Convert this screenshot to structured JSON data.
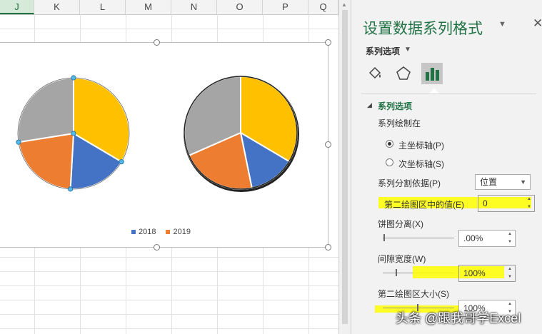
{
  "spreadsheet": {
    "columns": [
      "J",
      "K",
      "L",
      "M",
      "N",
      "O",
      "P",
      "Q"
    ],
    "active_column": "J"
  },
  "chart_data": {
    "type": "pie",
    "subtype": "pie-of-pie",
    "legend": [
      "2018",
      "2019"
    ],
    "legend_position": "bottom",
    "colors": {
      "2018": "#4472c4",
      "2019": "#ed7d31",
      "gray": "#a5a5a5",
      "yellow": "#ffc000"
    },
    "pies": [
      {
        "slices": [
          {
            "color": "#ffc000",
            "share": 0.335
          },
          {
            "color": "#4472c4",
            "share": 0.174
          },
          {
            "color": "#ed7d31",
            "share": 0.216
          },
          {
            "color": "#a5a5a5",
            "share": 0.275
          }
        ]
      },
      {
        "slices": [
          {
            "color": "#ffc000",
            "share": 0.335
          },
          {
            "color": "#4472c4",
            "share": 0.133
          },
          {
            "color": "#ed7d31",
            "share": 0.216
          },
          {
            "color": "#a5a5a5",
            "share": 0.316
          }
        ]
      }
    ]
  },
  "pane": {
    "title": "设置数据系列格式",
    "subtitle": "系列选项",
    "section": "系列选项",
    "plot_on_label": "系列绘制在",
    "primary_axis": "主坐标轴(P)",
    "secondary_axis": "次坐标轴(S)",
    "split_by_label": "系列分割依据(P)",
    "split_by_value": "位置",
    "values_in_second_label": "第二绘图区中的值(E)",
    "values_in_second_value": "0",
    "explosion_label": "饼图分离(X)",
    "explosion_value": ".00%",
    "gap_width_label": "间隙宽度(W)",
    "gap_width_value": "100%",
    "second_size_label": "第二绘图区大小(S)",
    "second_size_value": "100%"
  },
  "watermark": "头条 @跟我哥学Excel"
}
